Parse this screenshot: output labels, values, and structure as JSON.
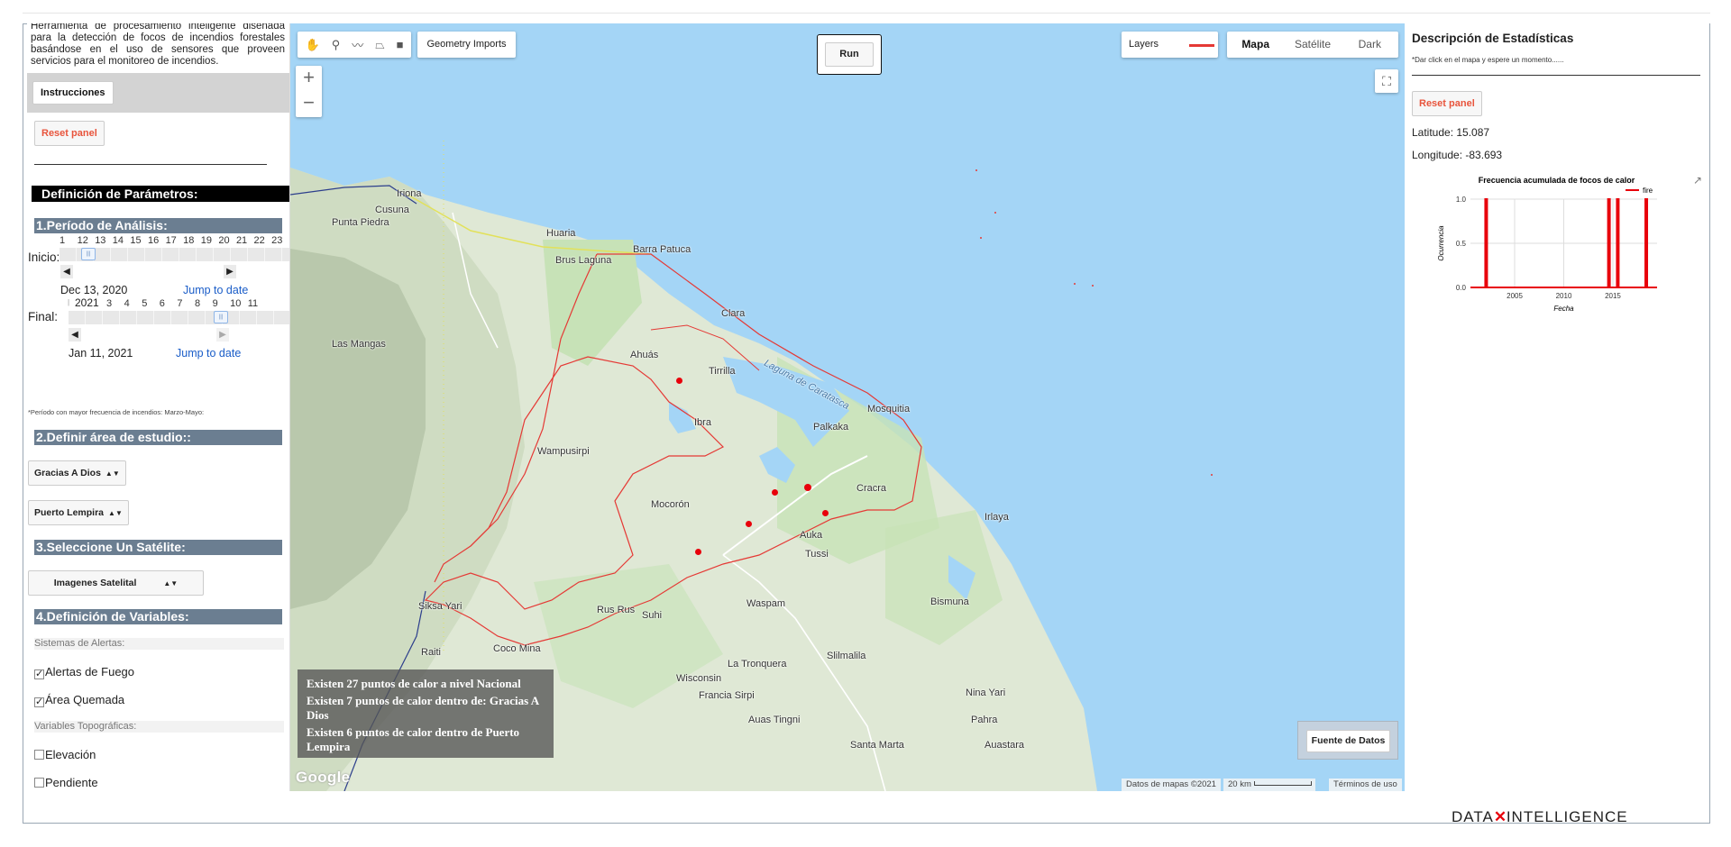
{
  "left": {
    "intro": "Herramienta de procesamiento inteligente diseñada para la detección de focos de incendios forestales basándose en el uso de sensores que proveen servicios para el monitoreo de incendios.",
    "instrucciones_label": "Instrucciones",
    "reset_label": "Reset panel",
    "def_title": "Definición de Parámetros:",
    "sec1": "1.Período de Análisis:",
    "inicio_label": "Inicio:",
    "inicio_ticks": [
      "1",
      "12",
      "13",
      "14",
      "15",
      "16",
      "17",
      "18",
      "19",
      "20",
      "21",
      "22",
      "23"
    ],
    "inicio_date": "Dec 13, 2020",
    "final_label": "Final:",
    "final_year": "2021",
    "final_ticks": [
      "3",
      "4",
      "5",
      "6",
      "7",
      "8",
      "9",
      "10",
      "11"
    ],
    "final_date": "Jan 11, 2021",
    "jump_label": "Jump to date",
    "period_note": "*Período con mayor frecuencia de incendios: Marzo-Mayo:",
    "sec2": "2.Definir área de estudio::",
    "select_departamento": "Gracias A Dios",
    "select_municipio": "Puerto Lempira",
    "sec3": "3.Seleccione Un Satélite:",
    "select_satelite": "Imagenes Satelital",
    "sec4": "4.Definición de Variables:",
    "alertas_label": "Sistemas de Alertas:",
    "chk_fuego": "Alertas de Fuego",
    "chk_quemada": "Área Quemada",
    "topo_label": "Variables Topográficas:",
    "chk_elevacion": "Elevación",
    "chk_pendiente": "Pendiente"
  },
  "map": {
    "geometry_imports": "Geometry Imports",
    "run": "Run",
    "layers": "Layers",
    "maptypes": [
      "Mapa",
      "Satélite",
      "Dark"
    ],
    "active_maptype": "Mapa",
    "info": [
      "Existen 27 puntos de calor a nivel Nacional",
      "Existen 7 puntos de calor dentro de: Gracias A Dios",
      "Existen 6 puntos de calor dentro de Puerto Lempira"
    ],
    "fuente": "Fuente de Datos",
    "attrib_data": "Datos de mapas ©2021",
    "scale": "20 km",
    "terms": "Términos de uso",
    "google": "Google",
    "places": {
      "iriona": "Iriona",
      "cusuna": "Cusuna",
      "punta_piedra": "Punta Piedra",
      "huaria": "Huaria",
      "brus_laguna": "Brus Laguna",
      "barra_patuca": "Barra Patuca",
      "las_mangas": "Las Mangas",
      "clara": "Clara",
      "ahuas": "Ahuás",
      "auka_top": "Auka",
      "tirrilla": "Tirrilla",
      "laguna_caratasca": "Laguna de Caratasca",
      "palkaka": "Palkaka",
      "mosquitia": "Mosquitia",
      "ibra": "Ibra",
      "wampusirpi": "Wampusirpi",
      "mocoron": "Mocorón",
      "cracra": "Cracra",
      "irlaya": "Irlaya",
      "auka": "Auka",
      "tussi": "Tussi",
      "siksa_yari": "Siksa Yari",
      "rus_rus": "Rus Rus",
      "suhi": "Suhi",
      "waspam": "Waspam",
      "bismuna": "Bismuna",
      "raiti": "Raiti",
      "coco_mina": "Coco Mina",
      "wisconsin": "Wisconsin",
      "la_tronquera": "La Tronquera",
      "slilmalila": "Slilmalila",
      "francia_sirpi": "Francia Sirpi",
      "nina_yari": "Nina Yari",
      "auas_tingni": "Auas Tingni",
      "pahra": "Pahra",
      "santa_marta": "Santa Marta",
      "auastara": "Auastara"
    }
  },
  "right": {
    "title": "Descripción de Estadísticas",
    "hint": "*Dar click en el mapa y espere un momento......",
    "reset_label": "Reset panel",
    "latitude": "Latitude: 15.087",
    "longitude": "Longitude: -83.693"
  },
  "chart_data": {
    "type": "line",
    "title": "Frecuencia acumulada de focos de calor",
    "xlabel": "Fecha",
    "ylabel": "Ocurrencia",
    "xlim": [
      2000.5,
      2019.5
    ],
    "ylim": [
      0,
      1
    ],
    "yticks": [
      "0.0",
      "0.5",
      "1.0"
    ],
    "xticks": [
      "2005",
      "2010",
      "2015"
    ],
    "grid": true,
    "legend_position": "top-right",
    "series": [
      {
        "name": "fire",
        "color": "#e8000b",
        "spikes_years": [
          2002.1,
          2014.6,
          2015.5,
          2018.4
        ]
      }
    ]
  },
  "footer": {
    "brand_left": "DATA",
    "brand_right": "INTELLIGENCE",
    "accent": "#e8000b"
  },
  "colors": {
    "section_bar": "#6b7e91",
    "water": "#a4d5f6",
    "boundary": "#e53935",
    "hotspot": "#e8000b"
  }
}
